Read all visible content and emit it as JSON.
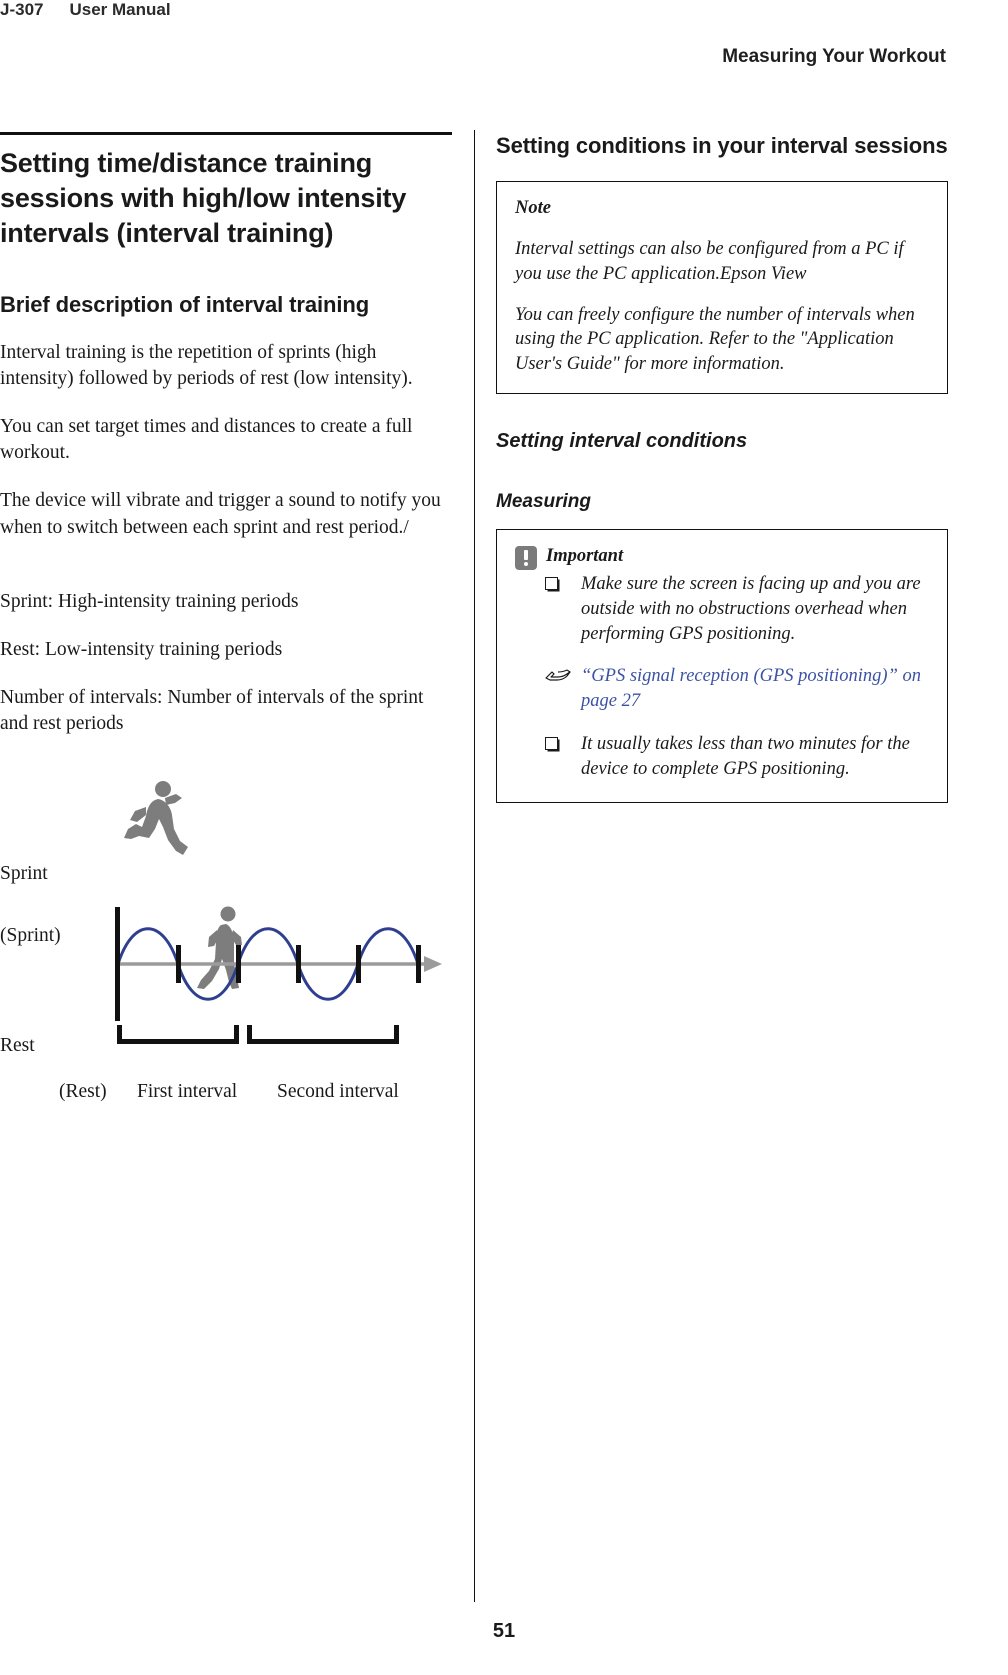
{
  "header": {
    "model": "J-307",
    "manual_label": "User Manual",
    "chapter_title": "Measuring Your Workout"
  },
  "left_column": {
    "h1": "Setting time/distance training sessions with high/low intensity intervals (interval training)",
    "h2": "Brief description of interval training",
    "paragraphs": [
      "Interval training is the repetition of sprints (high intensity) followed by periods of rest (low intensity).",
      "You can set target times and distances to create a full workout.",
      "The device will vibrate and trigger a sound to notify you when to switch between each sprint and rest period./",
      "Sprint: High-intensity training periods",
      "Rest: Low-intensity training periods",
      "Number of intervals: Number of intervals of the sprint and rest periods"
    ],
    "figure": {
      "label_sprint": "Sprint",
      "label_sprint_paren": "(Sprint)",
      "label_rest": "Rest",
      "caption_rest": "(Rest)",
      "caption_first": "First interval",
      "caption_second": "Second interval",
      "wave_color": "#2f3f8f",
      "axis_color": "#9b9b9b",
      "runner_color": "#7d7d7d",
      "tick_color": "#111111"
    }
  },
  "right_column": {
    "h2": "Setting conditions in your interval sessions",
    "note": {
      "title": "Note",
      "paragraphs": [
        "Interval settings can also be configured from a PC if you use the PC application.Epson View",
        "You can freely configure the number of intervals when using the PC application. Refer to the \"Application User's Guide\" for more information."
      ]
    },
    "h3": "Setting interval conditions",
    "h4": "Measuring",
    "important": {
      "title": "Important",
      "items": [
        "Make sure the screen is facing up and you are outside with no obstructions overhead when performing GPS positioning.",
        "It usually takes less than two minutes for the device to complete GPS positioning."
      ],
      "xref": "“GPS signal reception (GPS positioning)” on page 27",
      "xref_color": "#3b52a4"
    }
  },
  "footer": {
    "page_number": "51"
  }
}
